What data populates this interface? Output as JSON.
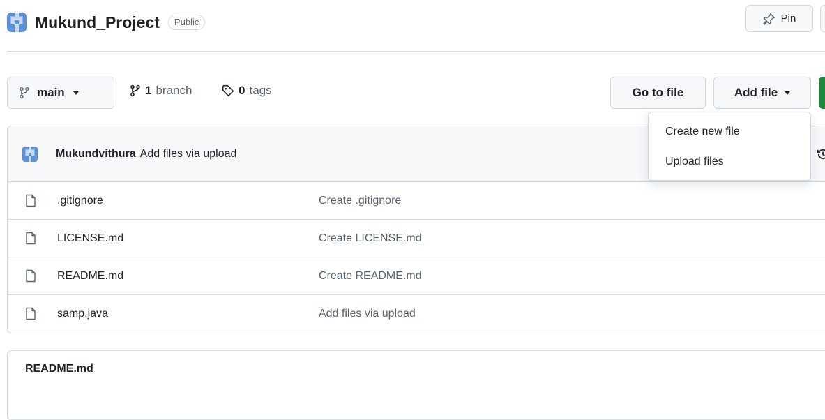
{
  "repo": {
    "name": "Mukund_Project",
    "visibility": "Public",
    "pin_label": "Pin"
  },
  "toolbar": {
    "branch": "main",
    "branch_count": "1",
    "branch_word": "branch",
    "tag_count": "0",
    "tag_word": "tags",
    "go_to_file": "Go to file",
    "add_file": "Add file"
  },
  "dropdown": {
    "items": [
      "Create new file",
      "Upload files"
    ]
  },
  "commit": {
    "author": "Mukundvithura",
    "message": "Add files via upload"
  },
  "files": [
    {
      "name": ".gitignore",
      "commit": "Create .gitignore"
    },
    {
      "name": "LICENSE.md",
      "commit": "Create LICENSE.md"
    },
    {
      "name": "README.md",
      "commit": "Create README.md"
    },
    {
      "name": "samp.java",
      "commit": "Add files via upload"
    }
  ],
  "readme": {
    "title": "README.md"
  },
  "colors": {
    "accent_green": "#1f883d",
    "avatar_blue": "#5b8fd6",
    "avatar_light": "#c9dbf2"
  }
}
